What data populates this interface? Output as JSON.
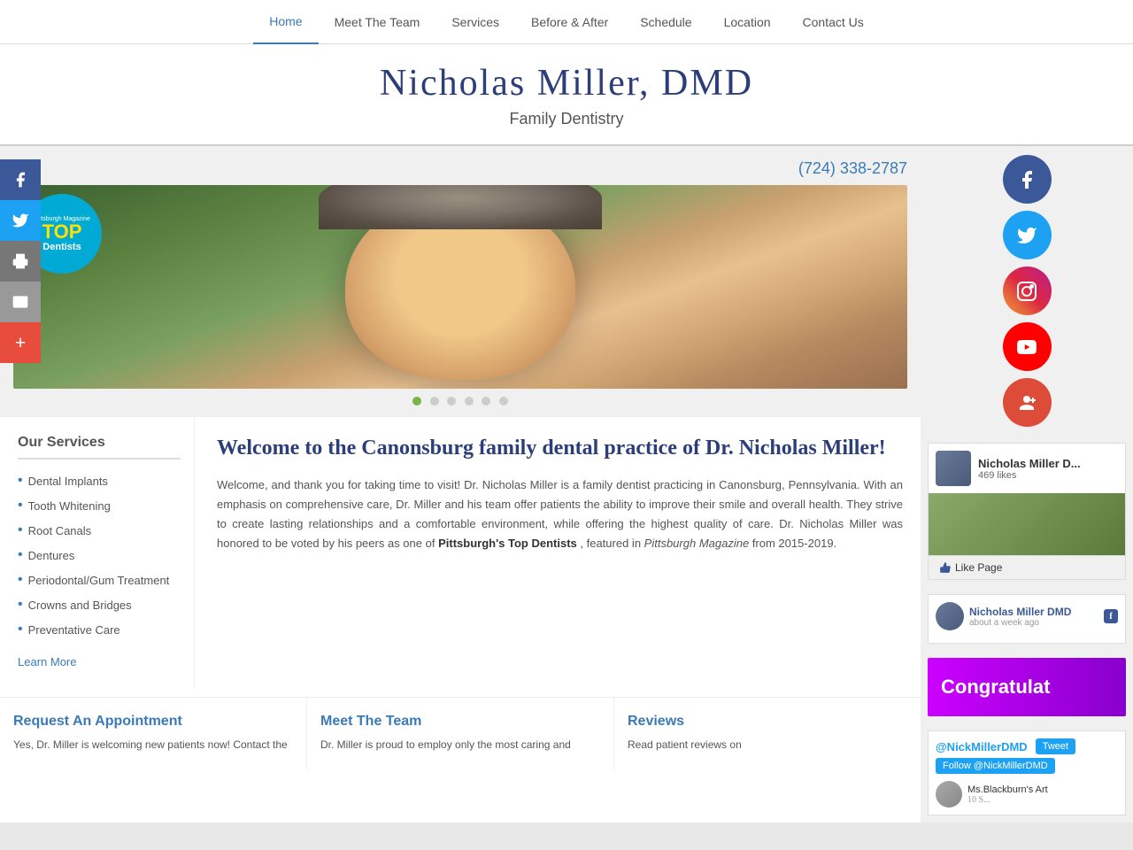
{
  "nav": {
    "items": [
      {
        "label": "Home",
        "active": true
      },
      {
        "label": "Meet The Team",
        "active": false
      },
      {
        "label": "Services",
        "active": false
      },
      {
        "label": "Before & After",
        "active": false
      },
      {
        "label": "Schedule",
        "active": false
      },
      {
        "label": "Location",
        "active": false
      },
      {
        "label": "Contact Us",
        "active": false
      }
    ]
  },
  "header": {
    "title": "Nicholas Miller, DMD",
    "subtitle": "Family Dentistry"
  },
  "hero": {
    "phone": "(724) 338-2787",
    "badge_mag": "Pittsburgh Magazine",
    "badge_top": "TOP",
    "badge_word": "Dentists"
  },
  "services": {
    "heading": "Our Services",
    "items": [
      {
        "label": "Dental Implants"
      },
      {
        "label": "Tooth Whitening"
      },
      {
        "label": "Root Canals"
      },
      {
        "label": "Dentures"
      },
      {
        "label": "Periodontal/Gum Treatment"
      },
      {
        "label": "Crowns and Bridges"
      },
      {
        "label": "Preventative Care"
      }
    ],
    "learn_more": "Learn More"
  },
  "welcome": {
    "heading": "Welcome to the Canonsburg family dental practice of Dr. Nicholas Miller!",
    "body": "Welcome, and thank you for taking time to visit! Dr. Nicholas Miller is a family dentist practicing in Canonsburg, Pennsylvania. With an emphasis on comprehensive care, Dr. Miller and his team offer patients the ability to improve their smile and overall health. They strive to create lasting relationships and a comfortable environment, while offering the highest quality of care. Dr. Nicholas Miller was honored to be voted by his peers as one of",
    "highlight1": "Pittsburgh's Top Dentists",
    "middle_text": ", featured in",
    "highlight2": "Pittsburgh Magazine",
    "end_text": "from 2015-2019."
  },
  "bottom_cols": {
    "appointment": {
      "heading": "Request An Appointment",
      "text": "Yes, Dr. Miller is welcoming new patients now! Contact the"
    },
    "team": {
      "heading": "Meet The Team",
      "text": "Dr. Miller is proud to employ only the most caring and"
    },
    "reviews": {
      "heading": "Reviews",
      "text": "Read patient reviews on"
    }
  },
  "right_sidebar": {
    "fb_page_name": "Nicholas Miller D...",
    "fb_likes": "469 likes",
    "fb_like_btn": "Like Page",
    "fb_post_name": "Nicholas Miller DMD",
    "fb_post_time": "about a week ago",
    "congrats_text": "Congratulat",
    "twitter_handle": "@NickMillerDMD",
    "tweet_btn": "Tweet",
    "follow_btn": "Follow @NickMillerDMD",
    "twitter_user_name": "Ms.Blackburn's Art",
    "twitter_user_count": "10 S..."
  },
  "left_social": {
    "facebook": "f",
    "twitter": "t",
    "print": "🖨",
    "email": "✉",
    "share": "+"
  }
}
